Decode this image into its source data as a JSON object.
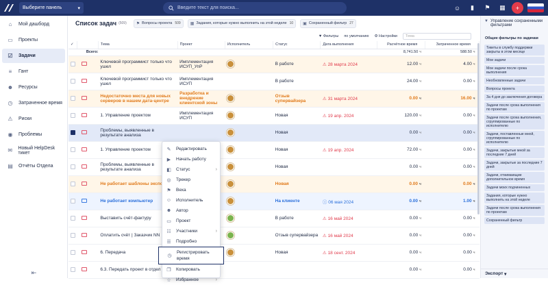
{
  "topbar": {
    "logo_text": "/\\",
    "panel_select": "Выберите панель",
    "search_placeholder": "Введите текст для поиска...",
    "accent": "#1e3167",
    "plus_color": "#e23b4a"
  },
  "sidebar": {
    "items": [
      {
        "label": "Мой дашборд",
        "icon": "home-icon"
      },
      {
        "label": "Проекты",
        "icon": "folder-icon"
      },
      {
        "label": "Задачи",
        "icon": "tasks-icon",
        "active": true
      },
      {
        "label": "Гант",
        "icon": "gantt-icon"
      },
      {
        "label": "Ресурсы",
        "icon": "users-icon"
      },
      {
        "label": "Затраченное время",
        "icon": "clock-icon"
      },
      {
        "label": "Риски",
        "icon": "risk-icon"
      },
      {
        "label": "Проблемы",
        "icon": "problem-icon"
      },
      {
        "label": "Новый HelpDesk тикет",
        "icon": "ticket-icon"
      },
      {
        "label": "Отчёты Отдела",
        "icon": "report-icon"
      }
    ]
  },
  "header": {
    "title": "Список задач",
    "count": "(509)",
    "chips": [
      {
        "label": "Вопросы проекта",
        "count": "509"
      },
      {
        "label": "Задания, которые нужно выполнить на этой неделе",
        "count": "10"
      },
      {
        "label": "Сохраненный фильтр",
        "count": "27"
      }
    ]
  },
  "toolbar": {
    "filters": "Фильтры",
    "default": "по умолчанию",
    "settings": "Настройки",
    "search_placeholder": "Тема"
  },
  "table": {
    "columns": [
      "Тема",
      "Проект",
      "Исполнитель",
      "Статус",
      "Дата выполнения",
      "Расчётное время",
      "Затраченное время"
    ],
    "total_label": "Всего:",
    "total_est": "8,741.50",
    "total_spent": "588.50",
    "unit": "ч",
    "rows": [
      {
        "theme": "Ключевой программист только что ушел",
        "project": "Имплементация ИСУП_УпР",
        "status": "В работе",
        "date": "28 марта 2024",
        "est": "12.00",
        "spent": "4.00",
        "style": "orange"
      },
      {
        "theme": "Ключевой программист только что ушел",
        "project": "Имплементация ИСУП",
        "status": "В работе",
        "date": "",
        "est": "24.00",
        "spent": "0.00",
        "style": ""
      },
      {
        "theme": "Недостаточно места для новых серверов в нашем дата-центре",
        "project": "Разработка и внедрение клиентской зоны",
        "status": "Отзыв супервайзера",
        "date": "31 марта 2024",
        "est": "0.00",
        "spent": "16.00",
        "style": "orange-bold"
      },
      {
        "theme": "1. Управление проектом",
        "project": "Имплементация ИСУП",
        "status": "Новая",
        "date": "19 апр. 2024",
        "est": "120.00",
        "spent": "0.00",
        "style": ""
      },
      {
        "theme": "Проблемы, выявленные в результате анализа",
        "project": "",
        "status": "Новая",
        "date": "",
        "est": "0.00",
        "spent": "0.00",
        "style": "sel"
      },
      {
        "theme": "1. Управление проектом",
        "project": "",
        "status": "Новая",
        "date": "19 апр. 2024",
        "est": "72.00",
        "spent": "0.00",
        "style": ""
      },
      {
        "theme": "Проблемы, выявленные в результате анализа",
        "project": "",
        "status": "Новая",
        "date": "",
        "est": "0.00",
        "spent": "0.00",
        "style": ""
      },
      {
        "theme": "Не работает шаблоны экспор",
        "project": "",
        "status": "Новая",
        "date": "",
        "est": "0.00",
        "spent": "0.00",
        "style": "orange-bold"
      },
      {
        "theme": "Не работает компьютер",
        "project": "",
        "status": "На клиенте",
        "date": "06 мая 2024",
        "est": "0.00",
        "spent": "1.00",
        "style": "blue"
      },
      {
        "theme": "Выставить счёт-фактуру",
        "project": "",
        "status": "В работе",
        "date": "16 май 2024",
        "est": "0.00",
        "spent": "0.00",
        "style": ""
      },
      {
        "theme": "Оплатить счёт | Заказчик NN",
        "project": "",
        "status": "Отзыв супервайзера",
        "date": "16 май 2024",
        "est": "0.00",
        "spent": "0.00",
        "style": ""
      },
      {
        "theme": "6. Передача",
        "project": "",
        "status": "Новая",
        "date": "18 сент. 2024",
        "est": "0.00",
        "spent": "0.00",
        "style": ""
      },
      {
        "theme": "6.3. Передать проект в отдел",
        "project": "",
        "status": "",
        "date": "",
        "est": "0.00",
        "spent": "0.00",
        "style": ""
      }
    ]
  },
  "context_menu": {
    "items": [
      {
        "label": "Редактировать",
        "icon": "edit-icon"
      },
      {
        "label": "Начать работу",
        "icon": "play-icon"
      },
      {
        "label": "Статус",
        "icon": "status-icon",
        "submenu": true
      },
      {
        "label": "Трекер",
        "icon": "tracker-icon"
      },
      {
        "label": "Веха",
        "icon": "flag-icon"
      },
      {
        "label": "Исполнитель",
        "icon": "assignee-icon"
      },
      {
        "label": "Автор",
        "icon": "author-icon"
      },
      {
        "label": "Проект",
        "icon": "project-icon"
      },
      {
        "label": "Участники",
        "icon": "participants-icon",
        "submenu": true
      },
      {
        "label": "Подробно",
        "icon": "details-icon"
      },
      {
        "label": "Регистрировать время",
        "icon": "log-time-icon",
        "highlight": true
      },
      {
        "label": "Копировать",
        "icon": "copy-icon"
      },
      {
        "label": "Избранное",
        "icon": "star-icon",
        "submenu": true
      }
    ]
  },
  "right_panel": {
    "title": "Управление сохраненными фильтрами",
    "subtitle": "Общие фильтры по задачам",
    "items": [
      "Тикеты в службу поддержки закрыты в этом месяце",
      "Мои задачи",
      "Мои задачи после срока выполнения",
      "Необновленные задачи",
      "Вопросы проекта",
      "За 4 дня до заключения договора",
      "Задачи после срока выполнения по проектам",
      "Задачи после срока выполнения, сгруппированные по исполнителю",
      "Задачи, поставленные мной, сгруппированные по исполнителю",
      "Задачи, закрытые мной за последние 7 дней",
      "Задачи, закрытые за последние 7 дней",
      "Задачи, отнимающие дополнительное время",
      "Задачи моих подчиненных",
      "Задания, которые нужно выполнить на этой неделе",
      "Задачи после срока выполнения по проектам",
      "Сохраненный фильтр"
    ],
    "footer": "Экспорт"
  }
}
